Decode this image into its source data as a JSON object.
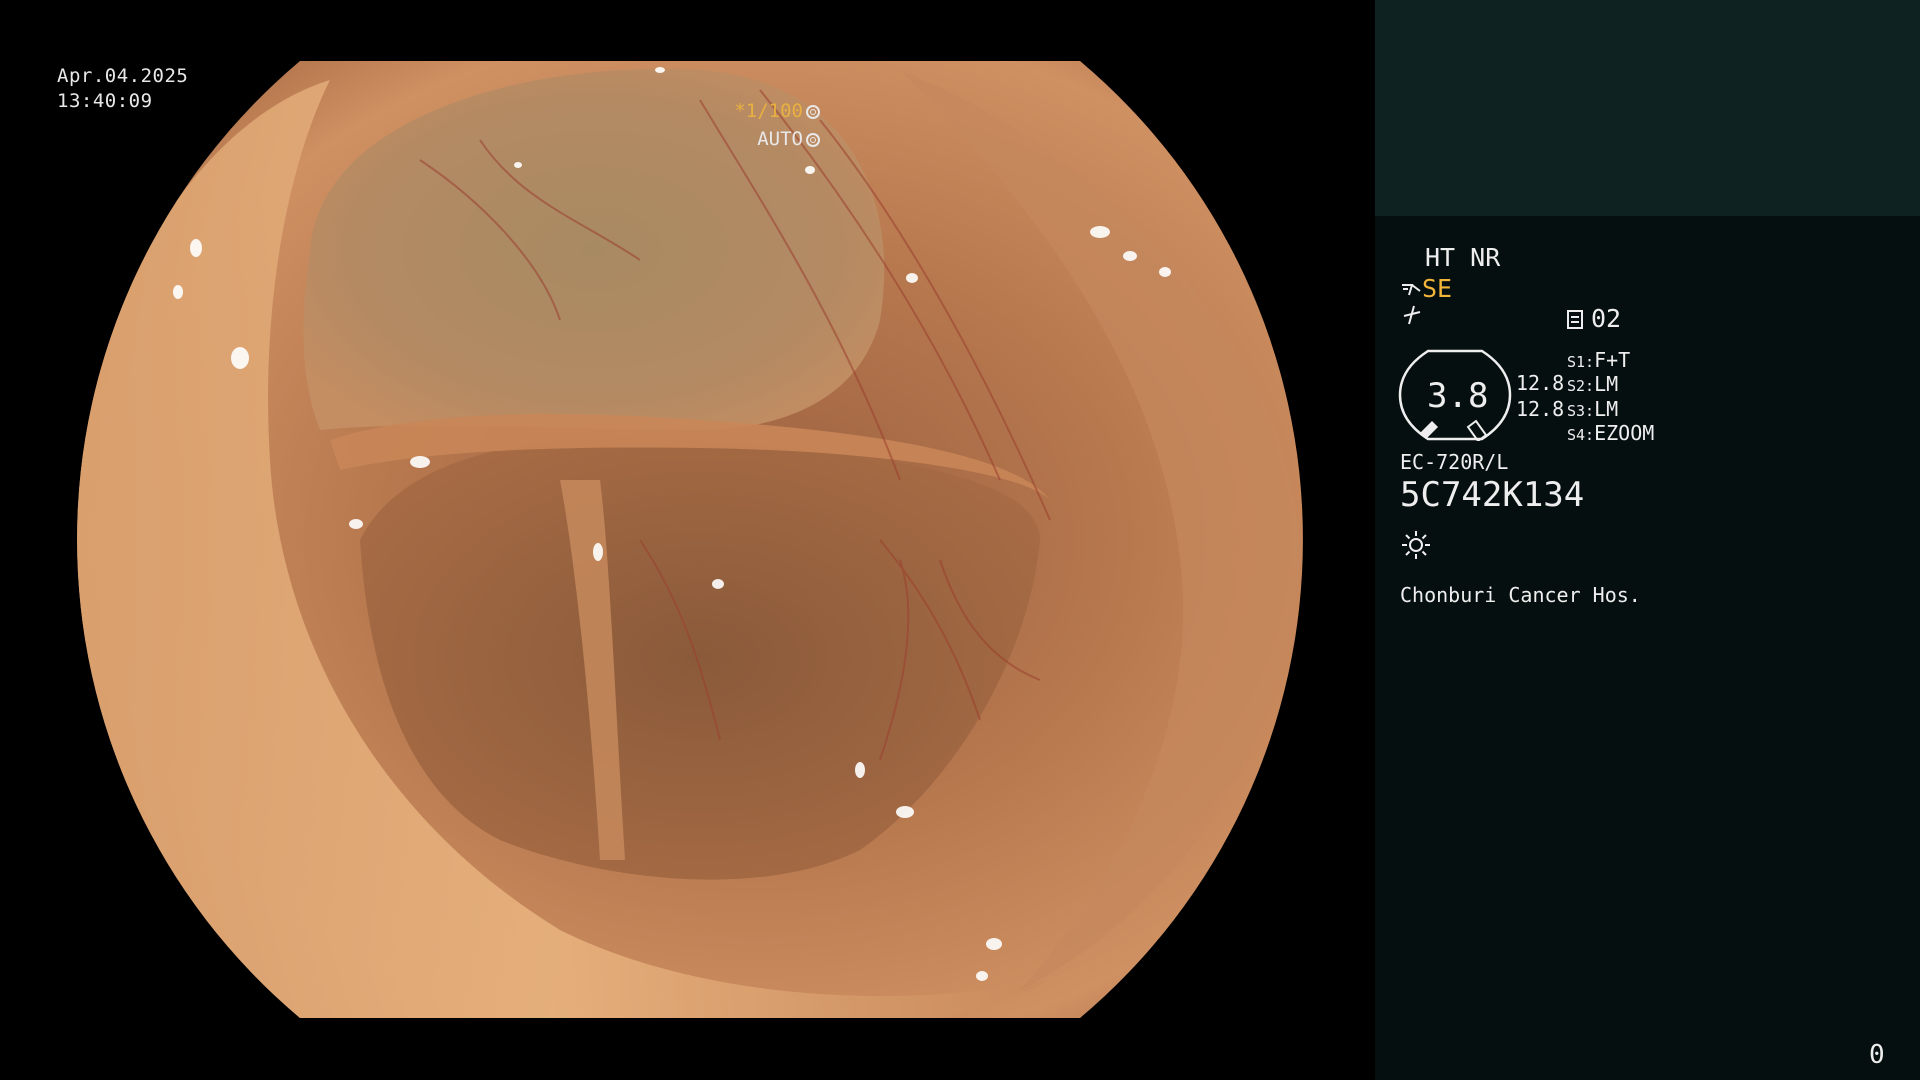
{
  "overlay": {
    "date": "Apr.04.2025",
    "time": "13:40:09",
    "shutter_value": "*1/100",
    "iris_mode": "AUTO",
    "shutter_icon": "aperture-icon",
    "iris_icon": "iris-icon"
  },
  "info_panel": {
    "mode_line1": "HT NR",
    "mode_se": "SE",
    "structure_icon": "structure-enhance-icon",
    "freeze_icon": "freeze-icon",
    "record_icon": "document-icon",
    "record_value": "02",
    "dial_value": "3.8",
    "gain_top": "12.8",
    "gain_bottom": "12.8",
    "switches": [
      {
        "label": "S1:",
        "value": "F+T"
      },
      {
        "label": "S2:",
        "value": "LM"
      },
      {
        "label": "S3:",
        "value": "LM"
      },
      {
        "label": "S4:",
        "value": "EZOOM"
      }
    ],
    "scope_model": "EC-720R/L",
    "scope_serial": "5C742K134",
    "light_icon": "light-source-icon",
    "hospital": "Chonburi Cancer Hos."
  },
  "counter": "0",
  "colors": {
    "accent_orange": "#f2b53a",
    "panel_header": "#0e2222",
    "panel_body": "#060f0f",
    "mucosa": "#c8875a"
  }
}
